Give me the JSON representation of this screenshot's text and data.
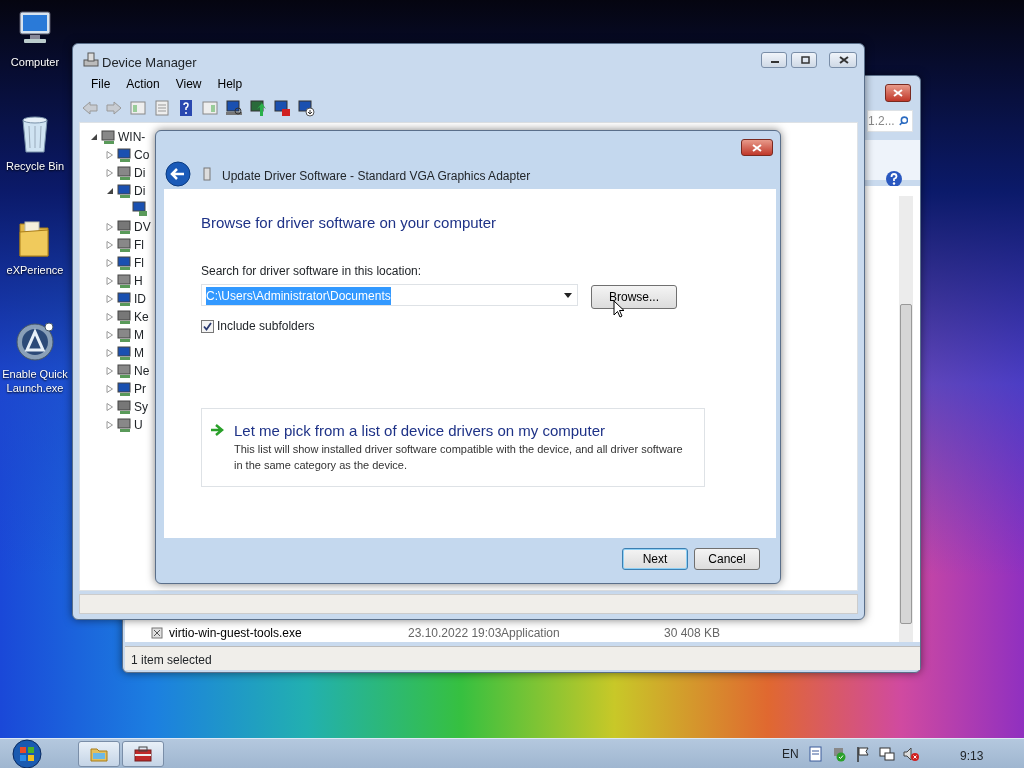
{
  "desktop_icons": [
    {
      "label": "Computer",
      "kind": "computer"
    },
    {
      "label": "Recycle Bin",
      "kind": "bin"
    },
    {
      "label": "eXPerience",
      "kind": "folder"
    },
    {
      "label": "Enable Quick Launch.exe",
      "kind": "app"
    }
  ],
  "explorer": {
    "search": "1.2...",
    "file": {
      "name": "virtio-win-guest-tools.exe",
      "date": "23.10.2022 19:03",
      "type": "Application",
      "size": "30 408 KB"
    },
    "status": "1 item selected"
  },
  "device_manager": {
    "title": "Device Manager",
    "menu": [
      "File",
      "Action",
      "View",
      "Help"
    ],
    "tree": {
      "label": "WIN-",
      "expanded": true,
      "children": [
        {
          "label": "Co",
          "expanded": false
        },
        {
          "label": "Di",
          "expanded": false
        },
        {
          "label": "Di",
          "expanded": true,
          "children": [
            {
              "kind": "device"
            }
          ]
        },
        {
          "label": "DV",
          "expanded": false
        },
        {
          "label": "Fl",
          "expanded": false
        },
        {
          "label": "Fl",
          "expanded": false
        },
        {
          "label": "H",
          "expanded": false
        },
        {
          "label": "ID",
          "expanded": false
        },
        {
          "label": "Ke",
          "expanded": false
        },
        {
          "label": "M",
          "expanded": false
        },
        {
          "label": "M",
          "expanded": false
        },
        {
          "label": "Ne",
          "expanded": false
        },
        {
          "label": "Pr",
          "expanded": false
        },
        {
          "label": "Sy",
          "expanded": false
        },
        {
          "label": "U",
          "expanded": false
        }
      ]
    }
  },
  "dialog": {
    "title": "Update Driver Software - Standard VGA Graphics Adapter",
    "heading": "Browse for driver software on your computer",
    "location_label": "Search for driver software in this location:",
    "location_value": "C:\\Users\\Administrator\\Documents",
    "browse": "Browse...",
    "include_subfolders": {
      "label": "Include subfolders",
      "checked": true
    },
    "option": {
      "title": "Let me pick from a list of device drivers on my computer",
      "description": "This list will show installed driver software compatible with the device, and all driver software in the same category as the device."
    },
    "buttons": [
      {
        "label": "Next",
        "default": true
      },
      {
        "label": "Cancel",
        "default": false
      }
    ]
  },
  "taskbar": {
    "language": "EN",
    "clock": "9:13"
  }
}
